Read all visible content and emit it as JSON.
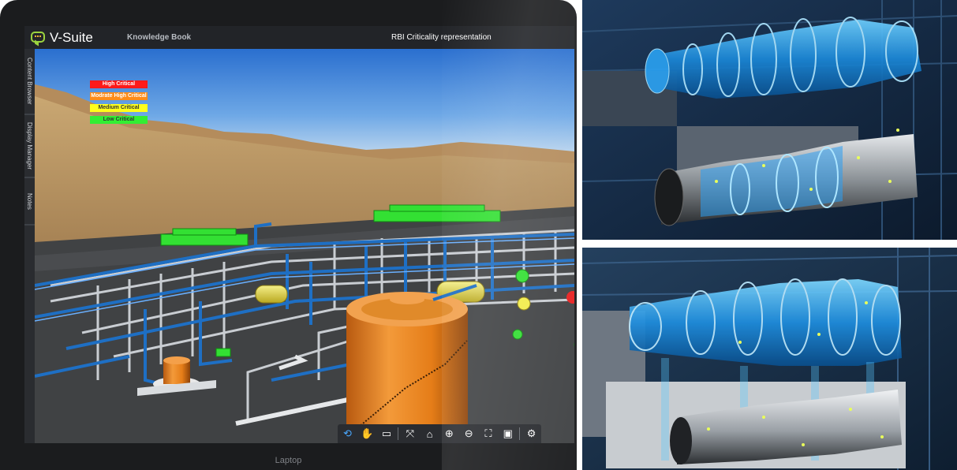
{
  "app": {
    "title": "V-Suite",
    "section": "Knowledge Book",
    "heading": "RBI Criticality representation"
  },
  "side_tabs": [
    "Content Browser",
    "Display Manager",
    "Notes"
  ],
  "legend": [
    {
      "label": "High Critical",
      "color": "#ff1a1a",
      "text_color": "#ffffff"
    },
    {
      "label": "Modrate High Critical",
      "color": "#ff8c1a",
      "text_color": "#ffffff"
    },
    {
      "label": "Medium Critical",
      "color": "#ffff1a",
      "text_color": "#333333"
    },
    {
      "label": "Low Critical",
      "color": "#33ee33",
      "text_color": "#333333"
    }
  ],
  "toolbar": [
    {
      "name": "orbit-icon",
      "glyph": "⟲"
    },
    {
      "name": "pan-hand-icon",
      "glyph": "✋"
    },
    {
      "name": "measure-ruler-icon",
      "glyph": "▭"
    },
    {
      "name": "fit-view-icon",
      "glyph": "⤧"
    },
    {
      "name": "home-icon",
      "glyph": "⌂"
    },
    {
      "name": "zoom-in-icon",
      "glyph": "⊕"
    },
    {
      "name": "zoom-out-icon",
      "glyph": "⊖"
    },
    {
      "name": "fullscreen-icon",
      "glyph": "⛶"
    },
    {
      "name": "focus-selection-icon",
      "glyph": "▣"
    },
    {
      "name": "settings-gear-icon",
      "glyph": "⚙"
    }
  ],
  "device_label": "Laptop"
}
